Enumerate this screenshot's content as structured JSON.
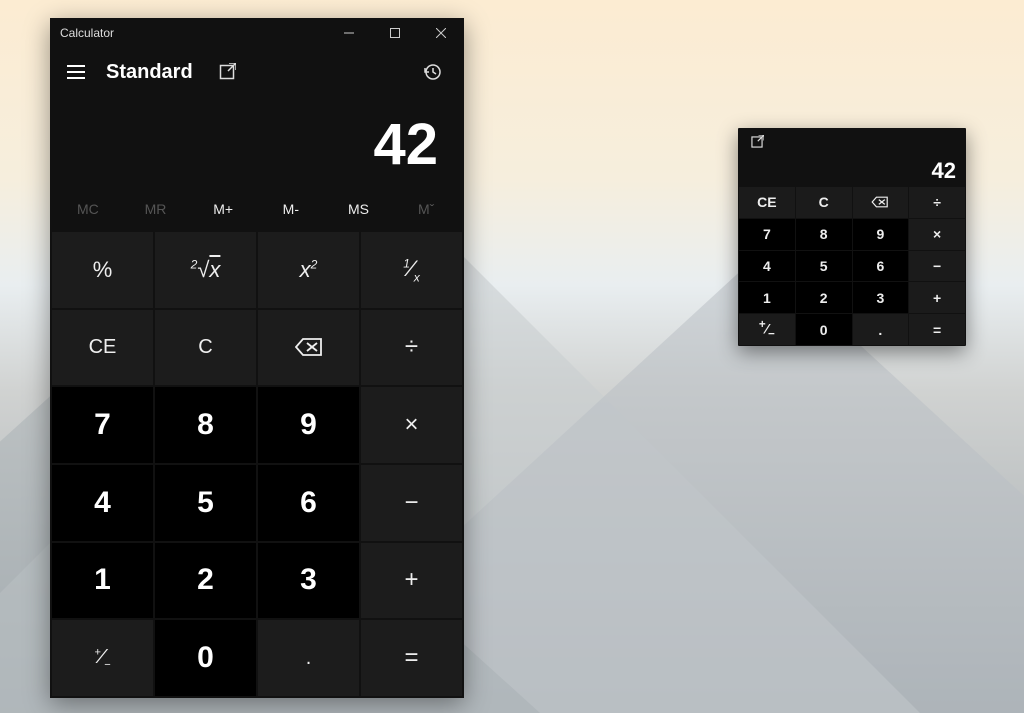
{
  "window": {
    "title": "Calculator",
    "mode": "Standard",
    "display": "42",
    "memory": {
      "mc": "MC",
      "mr": "MR",
      "mplus": "M+",
      "mminus": "M-",
      "ms": "MS",
      "mlist": "Mˇ"
    },
    "keys": {
      "percent": "%",
      "sqrt": "²√x",
      "square": "x²",
      "recip": "¹⁄x",
      "ce": "CE",
      "c": "C",
      "backspace": "⌫",
      "divide": "÷",
      "multiply": "×",
      "minus": "−",
      "plus": "+",
      "equals": "=",
      "negate": "⁺⁄₋",
      "decimal": ".",
      "n0": "0",
      "n1": "1",
      "n2": "2",
      "n3": "3",
      "n4": "4",
      "n5": "5",
      "n6": "6",
      "n7": "7",
      "n8": "8",
      "n9": "9"
    }
  },
  "mini": {
    "display": "42",
    "keys": {
      "ce": "CE",
      "c": "C",
      "backspace": "⌫",
      "divide": "÷",
      "multiply": "×",
      "minus": "−",
      "plus": "+",
      "equals": "=",
      "negate": "⁺⁄₋",
      "decimal": ".",
      "n0": "0",
      "n1": "1",
      "n2": "2",
      "n3": "3",
      "n4": "4",
      "n5": "5",
      "n6": "6",
      "n7": "7",
      "n8": "8",
      "n9": "9"
    }
  }
}
